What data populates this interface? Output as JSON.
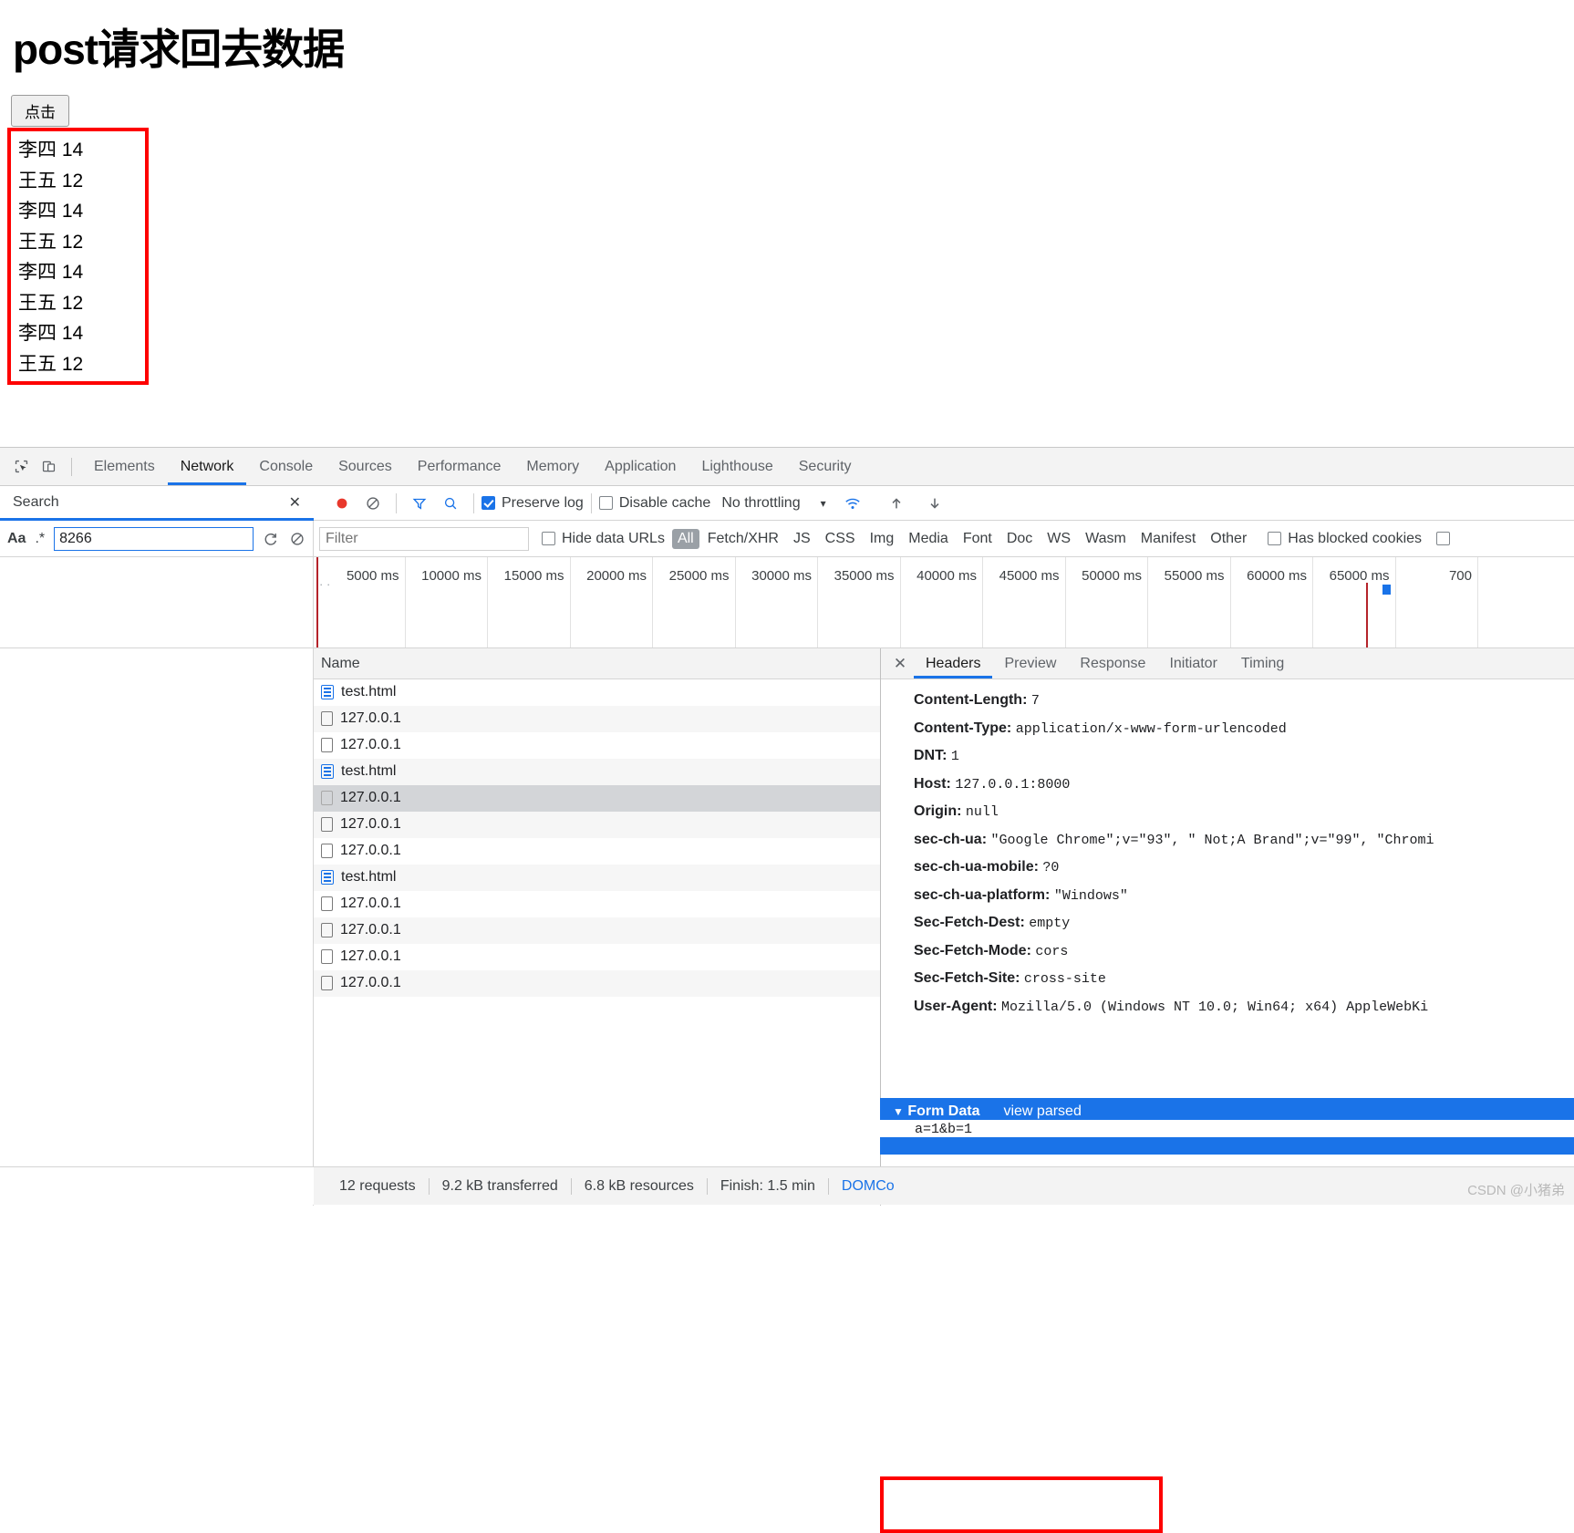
{
  "page": {
    "title": "post请求回去数据",
    "button_label": "点击",
    "results": [
      "李四 14",
      "王五 12",
      "李四 14",
      "王五 12",
      "李四 14",
      "王五 12",
      "李四 14",
      "王五 12"
    ],
    "highlight_color": "#fe0000"
  },
  "devtools": {
    "icons": {
      "inspect": "inspect-element-icon",
      "device": "device-toolbar-icon",
      "record": "record-icon",
      "clear": "clear-icon",
      "filter": "filter-funnel-icon",
      "search": "search-icon",
      "import": "import-har-icon",
      "export": "export-har-icon",
      "wifi": "online-status-icon"
    },
    "tabs": [
      {
        "label": "Elements",
        "active": false
      },
      {
        "label": "Network",
        "active": true
      },
      {
        "label": "Console",
        "active": false
      },
      {
        "label": "Sources",
        "active": false
      },
      {
        "label": "Performance",
        "active": false
      },
      {
        "label": "Memory",
        "active": false
      },
      {
        "label": "Application",
        "active": false
      },
      {
        "label": "Lighthouse",
        "active": false
      },
      {
        "label": "Security",
        "active": false
      }
    ],
    "search_panel": {
      "header_label": "Search",
      "close_label": "✕",
      "match_case_label": "Aa",
      "regex_label": ".*",
      "query_value": "8266",
      "query_placeholder": "",
      "refresh_icon": "refresh-icon",
      "clear_icon": "clear-search-icon"
    },
    "network_toolbar": {
      "preserve_log_label": "Preserve log",
      "preserve_log_checked": true,
      "disable_cache_label": "Disable cache",
      "disable_cache_checked": false,
      "throttling_label": "No throttling",
      "throttling_caret": "▾"
    },
    "filter_bar": {
      "filter_placeholder": "Filter",
      "filter_value": "",
      "hide_data_urls_label": "Hide data URLs",
      "hide_data_urls_checked": false,
      "types": [
        "All",
        "Fetch/XHR",
        "JS",
        "CSS",
        "Img",
        "Media",
        "Font",
        "Doc",
        "WS",
        "Wasm",
        "Manifest",
        "Other"
      ],
      "active_type": "All",
      "has_blocked_cookies_label": "Has blocked cookies",
      "has_blocked_cookies_checked": false,
      "blocked_requests_checked": false
    },
    "overview": {
      "ticks": [
        "5000 ms",
        "10000 ms",
        "15000 ms",
        "20000 ms",
        "25000 ms",
        "30000 ms",
        "35000 ms",
        "40000 ms",
        "45000 ms",
        "50000 ms",
        "55000 ms",
        "60000 ms",
        "65000 ms",
        "700"
      ]
    },
    "requests": {
      "column_header": "Name",
      "rows": [
        {
          "name": "test.html",
          "type": "doc",
          "selected": false
        },
        {
          "name": "127.0.0.1",
          "type": "xhr",
          "selected": false
        },
        {
          "name": "127.0.0.1",
          "type": "xhr",
          "selected": false
        },
        {
          "name": "test.html",
          "type": "doc",
          "selected": false
        },
        {
          "name": "127.0.0.1",
          "type": "xhr",
          "selected": true
        },
        {
          "name": "127.0.0.1",
          "type": "xhr",
          "selected": false
        },
        {
          "name": "127.0.0.1",
          "type": "xhr",
          "selected": false
        },
        {
          "name": "test.html",
          "type": "doc",
          "selected": false
        },
        {
          "name": "127.0.0.1",
          "type": "xhr",
          "selected": false
        },
        {
          "name": "127.0.0.1",
          "type": "xhr",
          "selected": false
        },
        {
          "name": "127.0.0.1",
          "type": "xhr",
          "selected": false
        },
        {
          "name": "127.0.0.1",
          "type": "xhr",
          "selected": false
        }
      ]
    },
    "detail": {
      "close_label": "✕",
      "tabs": [
        {
          "label": "Headers",
          "active": true
        },
        {
          "label": "Preview",
          "active": false
        },
        {
          "label": "Response",
          "active": false
        },
        {
          "label": "Initiator",
          "active": false
        },
        {
          "label": "Timing",
          "active": false
        }
      ],
      "headers": [
        {
          "key": "Content-Length:",
          "value": "7"
        },
        {
          "key": "Content-Type:",
          "value": "application/x-www-form-urlencoded"
        },
        {
          "key": "DNT:",
          "value": "1"
        },
        {
          "key": "Host:",
          "value": "127.0.0.1:8000"
        },
        {
          "key": "Origin:",
          "value": "null"
        },
        {
          "key": "sec-ch-ua:",
          "value": "\"Google Chrome\";v=\"93\", \" Not;A Brand\";v=\"99\", \"Chromi"
        },
        {
          "key": "sec-ch-ua-mobile:",
          "value": "?0"
        },
        {
          "key": "sec-ch-ua-platform:",
          "value": "\"Windows\""
        },
        {
          "key": "Sec-Fetch-Dest:",
          "value": "empty"
        },
        {
          "key": "Sec-Fetch-Mode:",
          "value": "cors"
        },
        {
          "key": "Sec-Fetch-Site:",
          "value": "cross-site"
        },
        {
          "key": "User-Agent:",
          "value": "Mozilla/5.0 (Windows NT 10.0; Win64; x64) AppleWebKi"
        }
      ],
      "form_data": {
        "section_label": "Form Data",
        "caret": "▼",
        "view_parsed_label": "view parsed",
        "value": "a=1&b=1"
      }
    },
    "statusbar": {
      "requests": "12 requests",
      "transferred": "9.2 kB transferred",
      "resources": "6.8 kB resources",
      "finish": "Finish: 1.5 min",
      "domcontent": "DOMCo"
    },
    "watermark": "CSDN @小猪弟"
  }
}
